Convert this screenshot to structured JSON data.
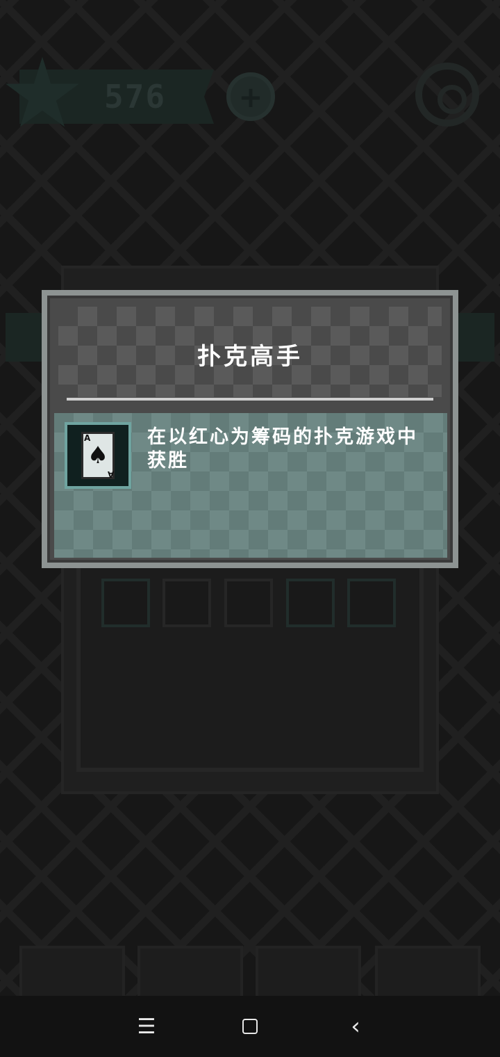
{
  "topbar": {
    "coins": "576",
    "plus_icon": "+"
  },
  "dialog": {
    "title": "扑克高手",
    "description": "在以红心为筹码的扑克游戏中获胜",
    "icon": {
      "name": "spade-ace-card-icon",
      "suit": "♠",
      "rank_top": "A",
      "rank_bottom": "A"
    }
  },
  "navbar": {
    "menu_icon": "☰",
    "back_icon": "‹"
  }
}
